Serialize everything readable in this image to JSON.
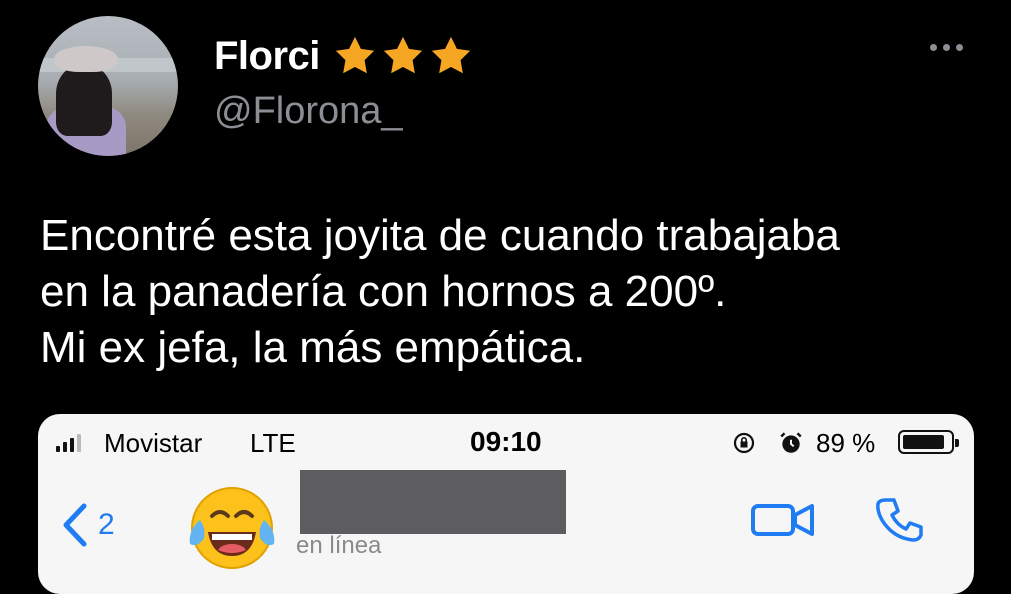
{
  "tweet": {
    "author_name": "Florci",
    "author_handle": "@Florona_",
    "star_count": 3,
    "star_color": "#f5a623",
    "text_lines": [
      "Encontré esta joyita de cuando trabajaba",
      "en la panadería con hornos a 200º.",
      "Mi ex jefa, la más empática."
    ],
    "more_icon": "ellipsis-icon"
  },
  "screenshot": {
    "status_bar": {
      "carrier": "Movistar",
      "network": "LTE",
      "time": "09:10",
      "battery_percent": "89 %",
      "battery_level": 0.89
    },
    "chat_header": {
      "back_count": "2",
      "contact_avatar": "face-with-tears-of-joy-emoji",
      "contact_name_redacted": true,
      "presence": "en línea",
      "accent_color": "#1f7cf2"
    }
  }
}
